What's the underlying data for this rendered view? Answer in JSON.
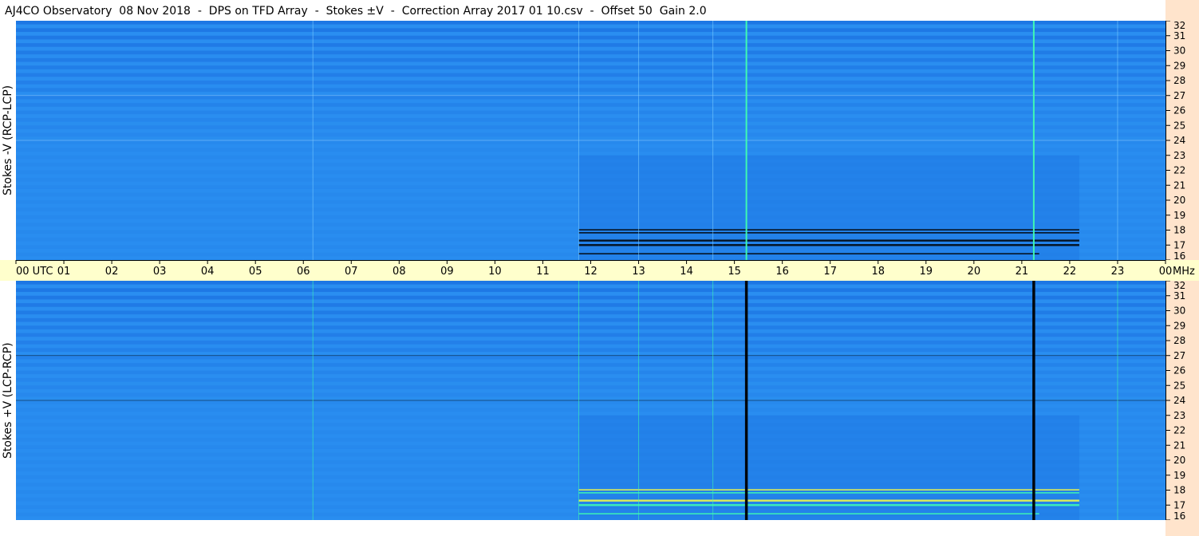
{
  "title": "AJ4CO Observatory  08 Nov 2018  -  DPS on TFD Array  -  Stokes ±V  -  Correction Array 2017 01 10.csv  -  Offset 50  Gain 2.0",
  "chart_data": {
    "type": "heatmap",
    "panels": [
      {
        "ylabel": "Stokes -V (RCP-LCP)",
        "polarity": "minus-v"
      },
      {
        "ylabel": "Stokes +V (LCP-RCP)",
        "polarity": "plus-v"
      }
    ],
    "time_axis": {
      "ticks": [
        "00 UTC",
        "01",
        "02",
        "03",
        "04",
        "05",
        "06",
        "07",
        "08",
        "09",
        "10",
        "11",
        "12",
        "13",
        "14",
        "15",
        "16",
        "17",
        "18",
        "19",
        "20",
        "21",
        "22",
        "23",
        "00"
      ],
      "range_hours": [
        0,
        24
      ]
    },
    "freq_axis": {
      "unit_label": "MHz",
      "ticks": [
        16,
        17,
        18,
        19,
        20,
        21,
        22,
        23,
        24,
        25,
        26,
        27,
        28,
        29,
        30,
        31,
        32
      ],
      "range_mhz": [
        16,
        32
      ]
    },
    "features": {
      "activity_start_utc": 11.75,
      "activity_end_utc": 22.2,
      "vertical_lines_utc": [
        6.2,
        11.75,
        13.0,
        14.55,
        15.25,
        21.25,
        23.0
      ],
      "horizontal_lines_mhz": [
        24.0,
        27.0
      ],
      "strong_bands_mhz": [
        17.0,
        17.3,
        17.8,
        18.0,
        16.4
      ]
    },
    "colors": {
      "background_low": "#1a6fe0",
      "background_mid": "#2a8ef0",
      "high": "#40ffb0",
      "peak": "#ffff40",
      "negative": "#000000",
      "time_axis_bg": "#ffffcc",
      "freq_axis_bg": "#ffe4cc"
    }
  }
}
